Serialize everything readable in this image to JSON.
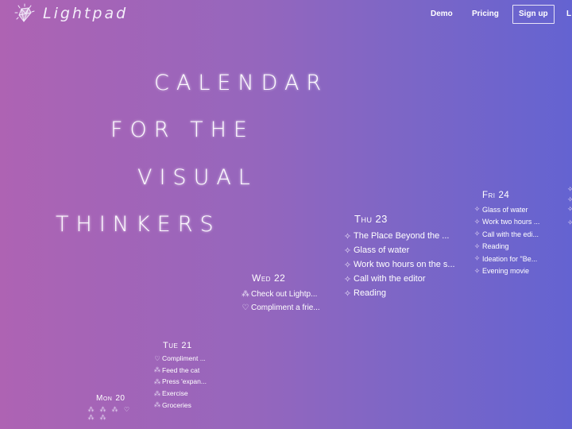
{
  "header": {
    "brand": "Lightpad",
    "logo_icon": "crystal-gem-icon",
    "nav": {
      "demo": "Demo",
      "pricing": "Pricing",
      "signup": "Sign up",
      "login_partial": "L"
    }
  },
  "headline": {
    "line1": "CALENDAR",
    "line2": "FOR THE",
    "line3": "VISUAL",
    "line4": "THINKERS"
  },
  "colors": {
    "gradient_left": "#ae63b3",
    "gradient_right": "#6463d1",
    "text": "#ffffff"
  },
  "days": {
    "mon": {
      "weekday": "Mon",
      "date": "20",
      "icons": [
        "shapes-icon",
        "shapes-icon",
        "shapes-icon",
        "heart-shield-icon",
        "shapes-icon",
        "shapes-icon"
      ]
    },
    "tue": {
      "weekday": "Tue",
      "date": "21",
      "tasks": [
        {
          "icon": "heart-shield-icon",
          "glyph": "♡",
          "label": "Compliment ..."
        },
        {
          "icon": "shapes-icon",
          "glyph": "⁂",
          "label": "Feed the cat"
        },
        {
          "icon": "shapes-icon",
          "glyph": "⁂",
          "label": "Press 'expan..."
        },
        {
          "icon": "shapes-icon",
          "glyph": "⁂",
          "label": "Exercise"
        },
        {
          "icon": "shapes-icon",
          "glyph": "⁂",
          "label": "Groceries"
        }
      ]
    },
    "wed": {
      "weekday": "Wed",
      "date": "22",
      "tasks": [
        {
          "icon": "shapes-icon",
          "glyph": "⁂",
          "label": "Check out Lightp..."
        },
        {
          "icon": "heart-shield-icon",
          "glyph": "♡",
          "label": "Compliment a frie..."
        }
      ]
    },
    "thu": {
      "weekday": "Thu",
      "date": "23",
      "tasks": [
        {
          "icon": "sparkle-icon",
          "glyph": "✧",
          "label": "The Place Beyond the ..."
        },
        {
          "icon": "sparkle-icon",
          "glyph": "✧",
          "label": "Glass of water"
        },
        {
          "icon": "sparkle-icon",
          "glyph": "✧",
          "label": "Work two hours on the s..."
        },
        {
          "icon": "sparkle-icon",
          "glyph": "✧",
          "label": "Call with the editor"
        },
        {
          "icon": "sparkle-icon",
          "glyph": "✧",
          "label": "Reading"
        }
      ]
    },
    "fri": {
      "weekday": "Fri",
      "date": "24",
      "tasks": [
        {
          "icon": "sparkle-icon",
          "glyph": "✧",
          "label": "Glass of water"
        },
        {
          "icon": "sparkle-icon",
          "glyph": "✧",
          "label": "Work two hours ..."
        },
        {
          "icon": "sparkle-icon",
          "glyph": "✧",
          "label": "Call with the edi..."
        },
        {
          "icon": "sparkle-icon",
          "glyph": "✧",
          "label": "Reading"
        },
        {
          "icon": "sparkle-icon",
          "glyph": "✧",
          "label": "Ideation for \"Be..."
        },
        {
          "icon": "sparkle-icon",
          "glyph": "✧",
          "label": "Evening movie"
        }
      ]
    },
    "sat_partial_icons": [
      "sparkle-icon",
      "sparkle-icon",
      "sparkle-icon",
      "sparkle-icon"
    ]
  },
  "glyphs": {
    "sparkle": "✧",
    "shapes": "⁂",
    "heart": "♡"
  }
}
